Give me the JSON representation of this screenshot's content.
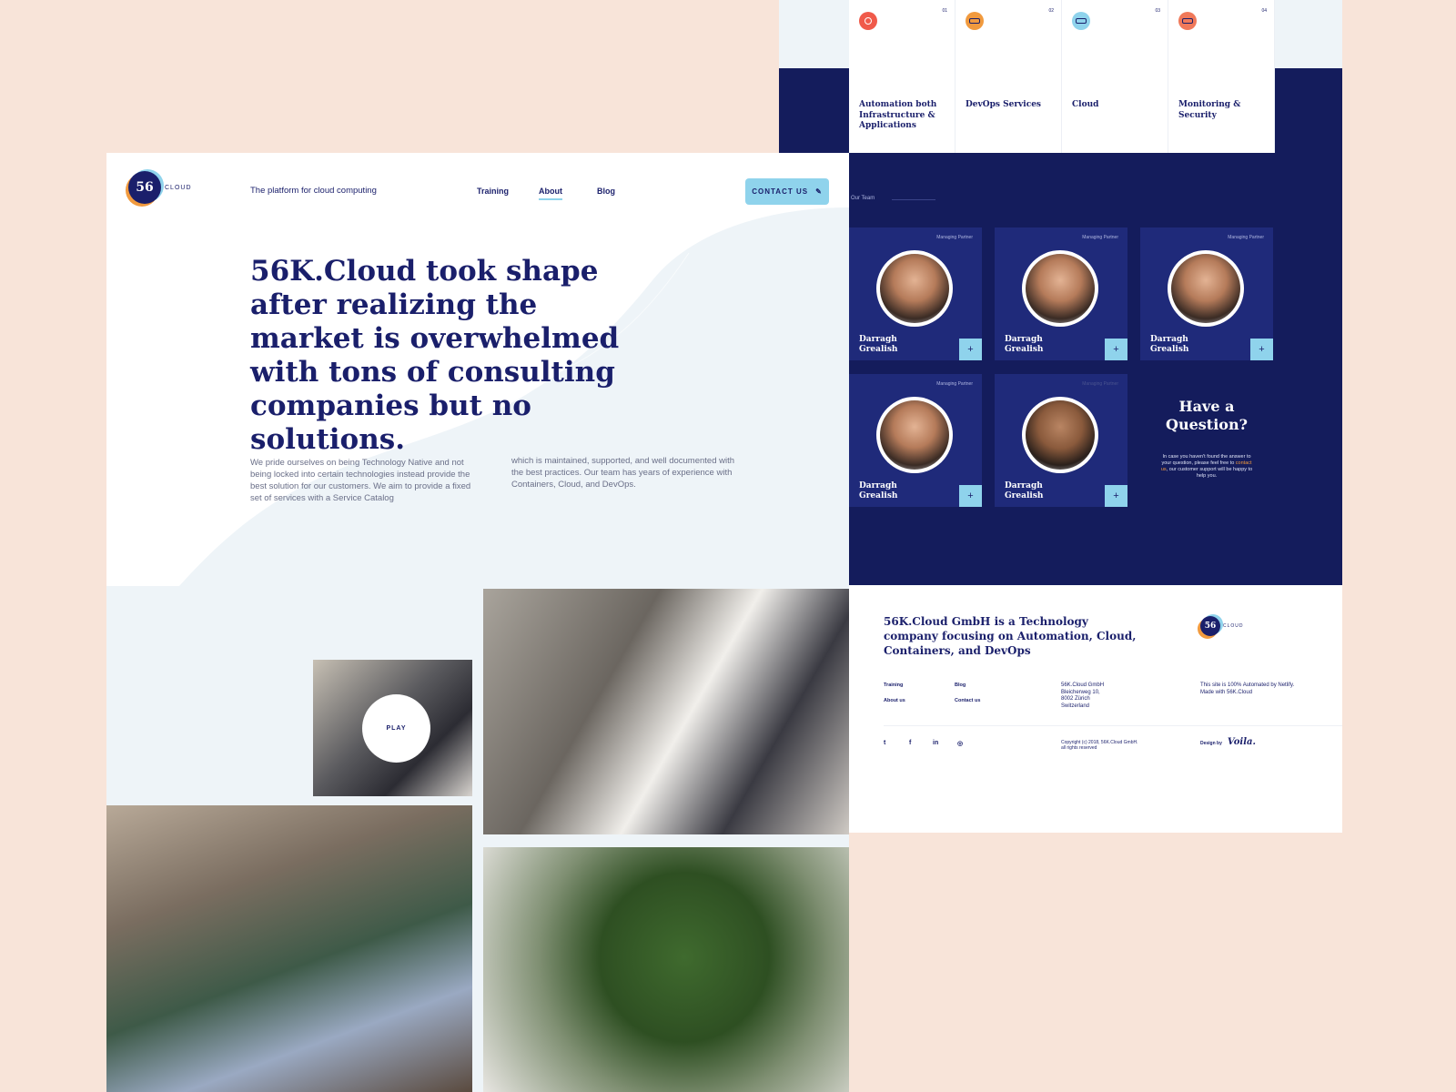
{
  "brand": {
    "logo_mark": "56",
    "logo_sub": "K",
    "logo_text": "CLOUD"
  },
  "header": {
    "tagline": "The platform for cloud computing",
    "nav": [
      "Training",
      "About",
      "Blog"
    ],
    "contact_label": "CONTACT US"
  },
  "hero": {
    "heading": "56K.Cloud took shape after realizing the market is overwhelmed with tons of consulting companies but no solutions.",
    "body_left": "We pride ourselves on being Technology Native and not being locked into certain technologies instead provide the best solution for our customers. We aim to provide a fixed set of services with a Service Catalog",
    "body_right": "which is maintained, supported, and well documented with the best practices. Our team has years of experience with Containers, Cloud, and DevOps."
  },
  "video": {
    "play_label": "PLAY"
  },
  "services": [
    {
      "num": "01",
      "title": "Automation both Infrastructure & Applications",
      "icon_color": "#f05a4a"
    },
    {
      "num": "02",
      "title": "DevOps Services",
      "icon_color": "#f19a3e"
    },
    {
      "num": "03",
      "title": "Cloud",
      "icon_color": "#8fd3ec"
    },
    {
      "num": "04",
      "title": "Monitoring & Security",
      "icon_color": "#f0795a"
    }
  ],
  "team": {
    "label": "Our Team",
    "members": [
      {
        "role": "Managing Partner",
        "name": "Darragh Grealish"
      },
      {
        "role": "Managing Partner",
        "name": "Darragh Grealish"
      },
      {
        "role": "Managing Partner",
        "name": "Darragh Grealish"
      },
      {
        "role": "Managing Partner",
        "name": "Darragh Grealish"
      },
      {
        "role": "Managing Partner",
        "name": "Darragh Grealish"
      }
    ],
    "plus": "+"
  },
  "question": {
    "title": "Have a Question?",
    "text_before": "In case you haven't found the answer to your question, please feel free to ",
    "link": "contact us",
    "text_after": ", our customer support will be happy to help you."
  },
  "footer": {
    "heading": "56K.Cloud GmbH is a Technology company focusing on Automation, Cloud, Containers, and DevOps",
    "links": [
      "Training",
      "Blog",
      "About us",
      "Contact us"
    ],
    "address": [
      "56K.Cloud GmbH",
      "Bleicherweg 10,",
      "8002 Zürich",
      "Switzerland"
    ],
    "automated": "This site is 100% Automated by Netlify.",
    "made_with": "Made with  56K.Cloud",
    "social": [
      "t",
      "f",
      "in",
      "◎"
    ],
    "copyright": "Copyright (c) 2018, 56K.Cloud GmbH.",
    "rights": "all rights reserved",
    "design_by": "Design by",
    "design_studio": "Voila."
  },
  "colors": {
    "navy": "#141c5c",
    "card": "#1f2a7a",
    "accent": "#8fd3ec",
    "orange": "#f19a3e",
    "peach": "#f8e4d9"
  }
}
